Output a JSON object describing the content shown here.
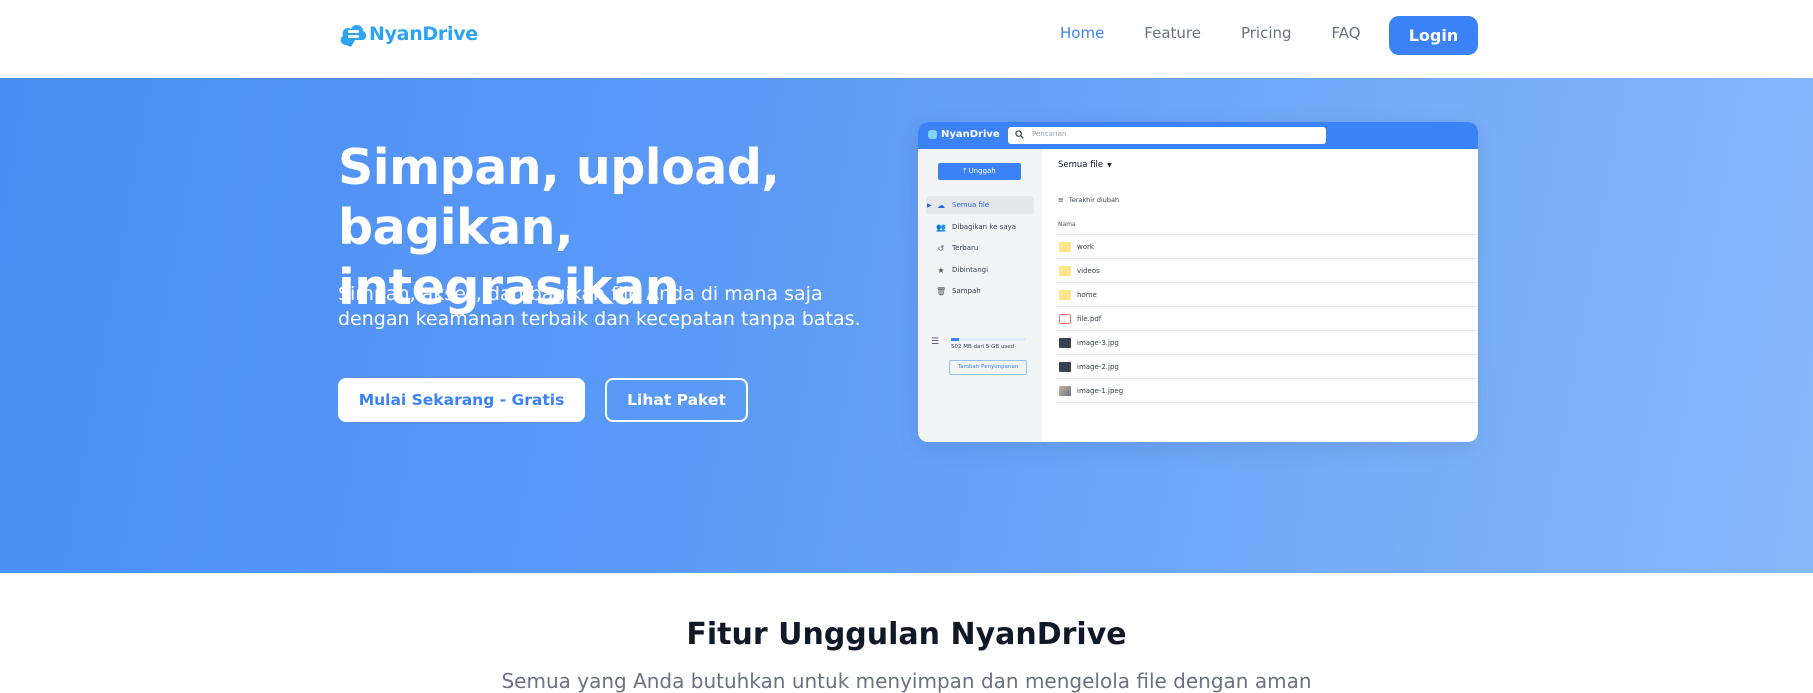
{
  "brand": {
    "name": "NyanDrive",
    "color": "#2ea3f2"
  },
  "nav": {
    "links": [
      "Home",
      "Feature",
      "Pricing",
      "FAQ"
    ],
    "active": "Home",
    "login": "Login"
  },
  "hero": {
    "title_line1": "Simpan, upload,",
    "title_line2": "bagikan, integrasikan",
    "subtitle": "Simpan, akses, dan bagikan file Anda di mana saja dengan keamanan terbaik dan kecepatan tanpa batas.",
    "cta_primary": "Mulai Sekarang - Gratis",
    "cta_secondary": "Lihat Paket",
    "gradient_from": "#4a8ef5",
    "gradient_to": "#86b8f9"
  },
  "mockup": {
    "app_name": "NyanDrive",
    "search_placeholder": "Pencarian",
    "upload_label": "Unggah",
    "sidebar": [
      {
        "label": "Semua file",
        "icon": "cloud-icon"
      },
      {
        "label": "Dibagikan ke saya",
        "icon": "users-icon"
      },
      {
        "label": "Terbaru",
        "icon": "history-icon"
      },
      {
        "label": "Dibintangi",
        "icon": "star-icon"
      },
      {
        "label": "Sampah",
        "icon": "trash-icon"
      }
    ],
    "storage_text": "502 MB dari 5 GB used",
    "storage_fraction": 0.1,
    "storage_button": "Tambah Penyimpanan",
    "breadcrumb": "Semua file",
    "sort_label": "Terakhir diubah",
    "column_name": "Nama",
    "files": [
      {
        "name": "work",
        "type": "folder"
      },
      {
        "name": "videos",
        "type": "folder"
      },
      {
        "name": "home",
        "type": "folder"
      },
      {
        "name": "file.pdf",
        "type": "pdf"
      },
      {
        "name": "image-3.jpg",
        "type": "image"
      },
      {
        "name": "image-2.jpg",
        "type": "image"
      },
      {
        "name": "image-1.jpeg",
        "type": "photo"
      }
    ]
  },
  "features": {
    "title": "Fitur Unggulan NyanDrive",
    "subtitle": "Semua yang Anda butuhkan untuk menyimpan dan mengelola file dengan aman"
  }
}
